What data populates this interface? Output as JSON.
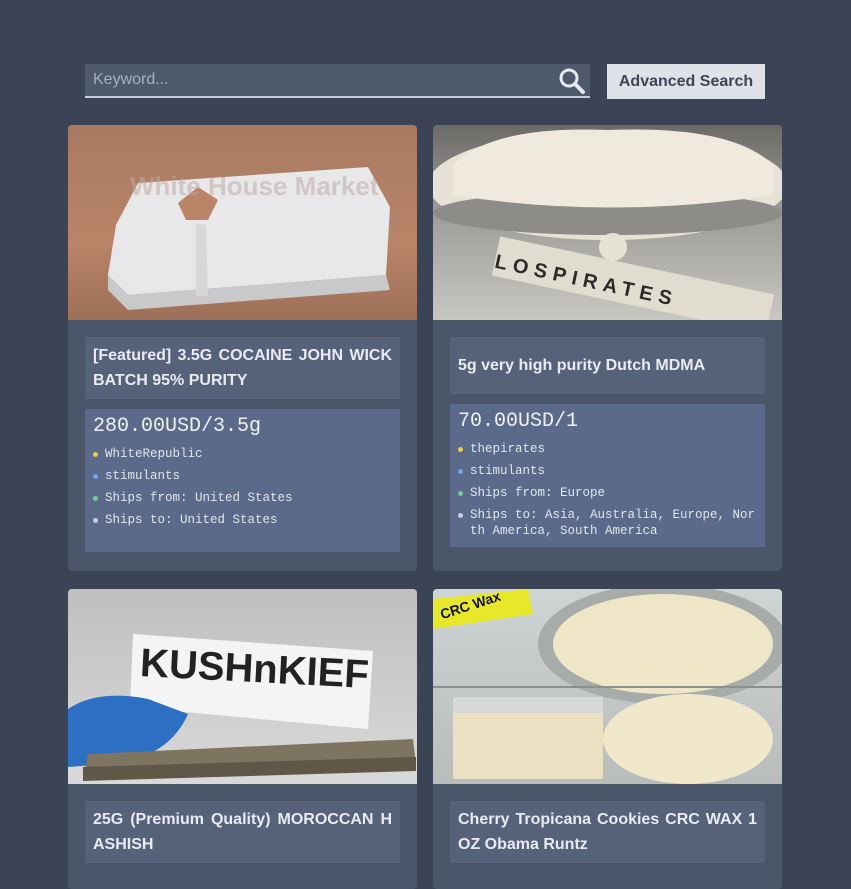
{
  "search": {
    "placeholder": "Keyword..."
  },
  "advanced_search_label": "Advanced Search",
  "colors": {
    "vendor_dot": "#f2c94c",
    "category_dot": "#6fa3ef",
    "ships_from_dot": "#6fcf97",
    "ships_to_dot": "#c9ced8"
  },
  "listings": [
    {
      "title": "[Featured] 3.5G COCAINE JOHN WICK BATCH 95% PURITY",
      "price": "280.00USD/3.5g",
      "vendor": "WhiteRepublic",
      "category": "stimulants",
      "ships_from": "Ships from: United States",
      "ships_to": "Ships to: United States",
      "image_watermark": "White House Market"
    },
    {
      "title": "5g very high purity Dutch MDMA",
      "price": "70.00USD/1",
      "vendor": "thepirates",
      "category": "stimulants",
      "ships_from": "Ships from: Europe",
      "ships_to": "Ships to: Asia, Australia, Europe, North America, South America",
      "image_label": "LOSPIRATES"
    },
    {
      "title": "25G (Premium Quality) MOROCCAN HASHISH",
      "image_label": "KUSHnKIEF"
    },
    {
      "title": "Cherry Tropicana Cookies CRC WAX 1 OZ Obama Runtz",
      "image_label": "CRC Wax"
    }
  ]
}
